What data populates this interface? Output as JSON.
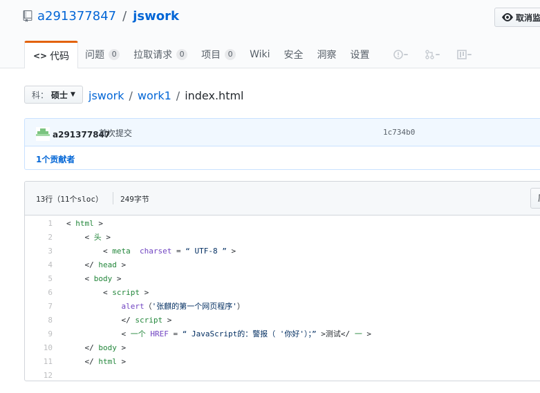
{
  "repo": {
    "owner": "a291377847",
    "separator": "/",
    "name": "jswork",
    "unwatch_label": "取消监"
  },
  "tabs": [
    {
      "label": "代码",
      "icon": "code-icon",
      "selected": true
    },
    {
      "label": "问题",
      "count": "0"
    },
    {
      "label": "拉取请求",
      "count": "0"
    },
    {
      "label": "项目",
      "count": "0"
    },
    {
      "label": "Wiki"
    },
    {
      "label": "安全"
    },
    {
      "label": "洞察"
    },
    {
      "label": "设置"
    }
  ],
  "branch": {
    "prefix": "科：",
    "name": "硕士"
  },
  "breadcrumb": {
    "root": "jswork",
    "folder": "work1",
    "file": "index.html",
    "sep": "/"
  },
  "commit": {
    "author": "a291377847",
    "message": "首次提交",
    "sha": "1c734b0",
    "contributors": "1个贡献者"
  },
  "file": {
    "lines_info": "13行（11个sloc）",
    "size": "249字节",
    "raw_label": "原"
  },
  "code_lines": [
    {
      "n": "1",
      "parts": [
        [
          "p",
          "< "
        ],
        [
          "tag",
          "html"
        ],
        [
          "p",
          " >"
        ]
      ]
    },
    {
      "n": "2",
      "parts": [
        [
          "p",
          "    < "
        ],
        [
          "tag",
          "头"
        ],
        [
          "p",
          " >"
        ]
      ]
    },
    {
      "n": "3",
      "parts": [
        [
          "p",
          "        < "
        ],
        [
          "tag",
          "meta"
        ],
        [
          "p",
          "  "
        ],
        [
          "attr",
          "charset"
        ],
        [
          "p",
          " = "
        ],
        [
          "str",
          "“ UTF-8 ”"
        ],
        [
          "p",
          " >"
        ]
      ]
    },
    {
      "n": "4",
      "parts": [
        [
          "p",
          "    </ "
        ],
        [
          "tag",
          "head"
        ],
        [
          "p",
          " >"
        ]
      ]
    },
    {
      "n": "5",
      "parts": [
        [
          "p",
          "    < "
        ],
        [
          "tag",
          "body"
        ],
        [
          "p",
          " >"
        ]
      ]
    },
    {
      "n": "6",
      "parts": [
        [
          "p",
          "        < "
        ],
        [
          "tag",
          "script"
        ],
        [
          "p",
          " >"
        ]
      ]
    },
    {
      "n": "7",
      "parts": [
        [
          "p",
          "            "
        ],
        [
          "fn",
          "alert"
        ],
        [
          "p",
          "（"
        ],
        [
          "str",
          "'张麒的第一个网页程序'"
        ],
        [
          "p",
          "）"
        ]
      ]
    },
    {
      "n": "8",
      "parts": [
        [
          "p",
          "            </ "
        ],
        [
          "tag",
          "script"
        ],
        [
          "p",
          " >"
        ]
      ]
    },
    {
      "n": "9",
      "parts": [
        [
          "p",
          "            < "
        ],
        [
          "tag",
          "一个"
        ],
        [
          "p",
          " "
        ],
        [
          "attr",
          "HREF"
        ],
        [
          "p",
          " = "
        ],
        [
          "str",
          "“ JavaScript的：警报（ '你好'）；”"
        ],
        [
          "p",
          " >测试</ "
        ],
        [
          "tag",
          "一"
        ],
        [
          "p",
          " >"
        ]
      ]
    },
    {
      "n": "10",
      "parts": [
        [
          "p",
          "    </ "
        ],
        [
          "tag",
          "body"
        ],
        [
          "p",
          " >"
        ]
      ]
    },
    {
      "n": "11",
      "parts": [
        [
          "p",
          "    </ "
        ],
        [
          "tag",
          "html"
        ],
        [
          "p",
          " >"
        ]
      ]
    },
    {
      "n": "12",
      "parts": [
        [
          "p",
          ""
        ]
      ]
    }
  ],
  "colors": {
    "accent_tab": "#e36209",
    "link": "#0366d6",
    "tag": "#22863a",
    "attr": "#6f42c1",
    "string": "#032f62"
  }
}
